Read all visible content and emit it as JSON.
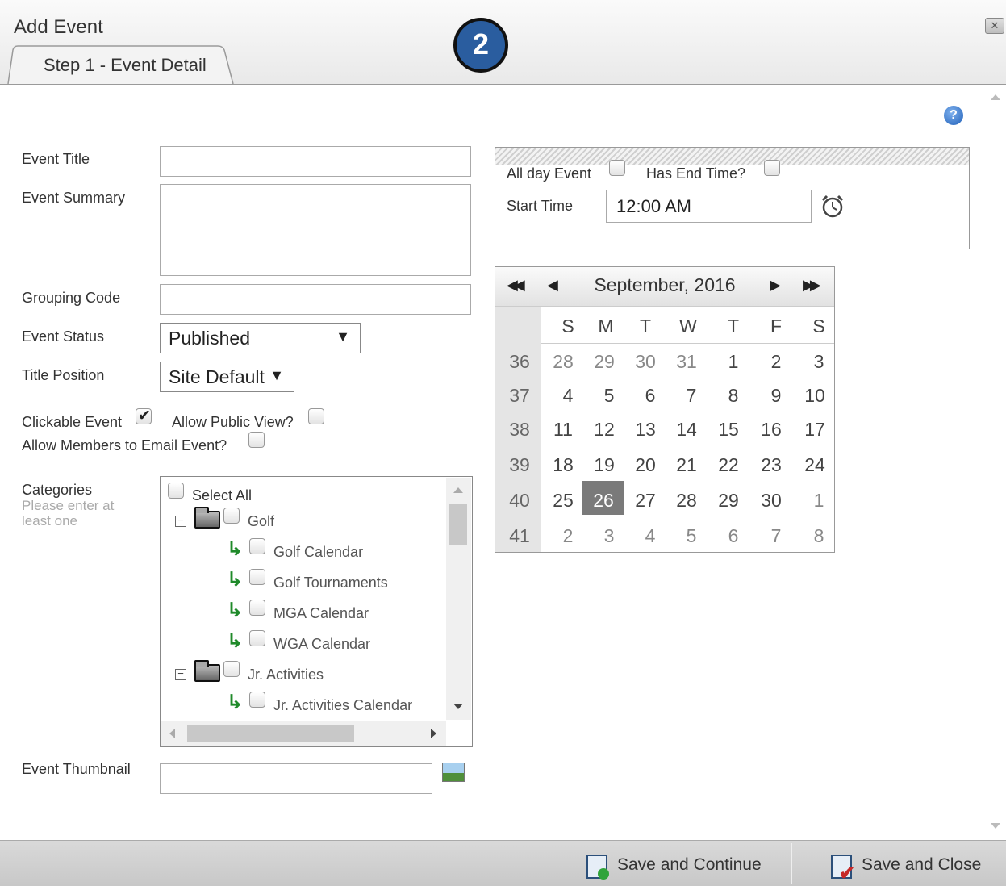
{
  "dialog": {
    "title": "Add Event",
    "step_badge": "2",
    "tab_label": "Step 1 - Event Detail",
    "help_icon": "?"
  },
  "form": {
    "event_title_label": "Event Title",
    "event_summary_label": "Event Summary",
    "grouping_code_label": "Grouping Code",
    "event_status_label": "Event Status",
    "event_status_value": "Published",
    "title_position_label": "Title Position",
    "title_position_value": "Site Default",
    "clickable_event_label": "Clickable Event",
    "clickable_event_checked": true,
    "allow_public_view_label": "Allow Public View?",
    "allow_members_email_label": "Allow Members to Email Event?",
    "categories_label": "Categories",
    "categories_hint_1": "Please enter at",
    "categories_hint_2": "least one",
    "event_thumbnail_label": "Event Thumbnail"
  },
  "categories": {
    "select_all": "Select All",
    "groups": [
      {
        "name": "Golf",
        "items": [
          "Golf Calendar",
          "Golf Tournaments",
          "MGA Calendar",
          "WGA Calendar"
        ]
      },
      {
        "name": "Jr. Activities",
        "items": [
          "Jr. Activities Calendar"
        ]
      }
    ]
  },
  "time": {
    "all_day_label": "All day Event",
    "has_end_time_label": "Has End Time?",
    "start_time_label": "Start Time",
    "start_time_value": "12:00 AM"
  },
  "calendar": {
    "title": "September, 2016",
    "nav_first": "◀◀",
    "nav_prev": "◀",
    "nav_next": "▶",
    "nav_last": "▶▶",
    "days_of_week": [
      "S",
      "M",
      "T",
      "W",
      "T",
      "F",
      "S"
    ],
    "weeks": [
      {
        "wk": "36",
        "days": [
          "28",
          "29",
          "30",
          "31",
          "1",
          "2",
          "3"
        ]
      },
      {
        "wk": "37",
        "days": [
          "4",
          "5",
          "6",
          "7",
          "8",
          "9",
          "10"
        ]
      },
      {
        "wk": "38",
        "days": [
          "11",
          "12",
          "13",
          "14",
          "15",
          "16",
          "17"
        ]
      },
      {
        "wk": "39",
        "days": [
          "18",
          "19",
          "20",
          "21",
          "22",
          "23",
          "24"
        ]
      },
      {
        "wk": "40",
        "days": [
          "25",
          "26",
          "27",
          "28",
          "29",
          "30",
          "1"
        ]
      },
      {
        "wk": "41",
        "days": [
          "2",
          "3",
          "4",
          "5",
          "6",
          "7",
          "8"
        ]
      }
    ],
    "selected_day": "26"
  },
  "footer": {
    "save_continue_label": "Save and Continue",
    "save_close_label": "Save and Close"
  }
}
